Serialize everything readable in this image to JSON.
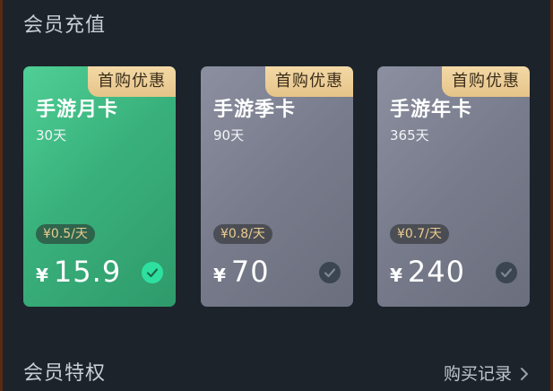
{
  "header": {
    "title": "会员充值"
  },
  "cards": [
    {
      "name": "手游月卡",
      "duration": "30天",
      "badge": "首购优惠",
      "per_day": "¥0.5/天",
      "currency": "¥",
      "price": "15.9",
      "selected": true
    },
    {
      "name": "手游季卡",
      "duration": "90天",
      "badge": "首购优惠",
      "per_day": "¥0.8/天",
      "currency": "¥",
      "price": "70",
      "selected": false
    },
    {
      "name": "手游年卡",
      "duration": "365天",
      "badge": "首购优惠",
      "per_day": "¥0.7/天",
      "currency": "¥",
      "price": "240",
      "selected": false
    }
  ],
  "privileges": {
    "title": "会员特权",
    "link_label": "购买记录"
  },
  "icons": {
    "check": "check-circle-icon",
    "chevron": "chevron-right-icon"
  },
  "colors": {
    "selected_card": "#39b17c",
    "unselected_card": "#777b8b",
    "badge": "#f3d9a6",
    "check_selected": "#2ee0a0",
    "background": "#1c232b"
  }
}
